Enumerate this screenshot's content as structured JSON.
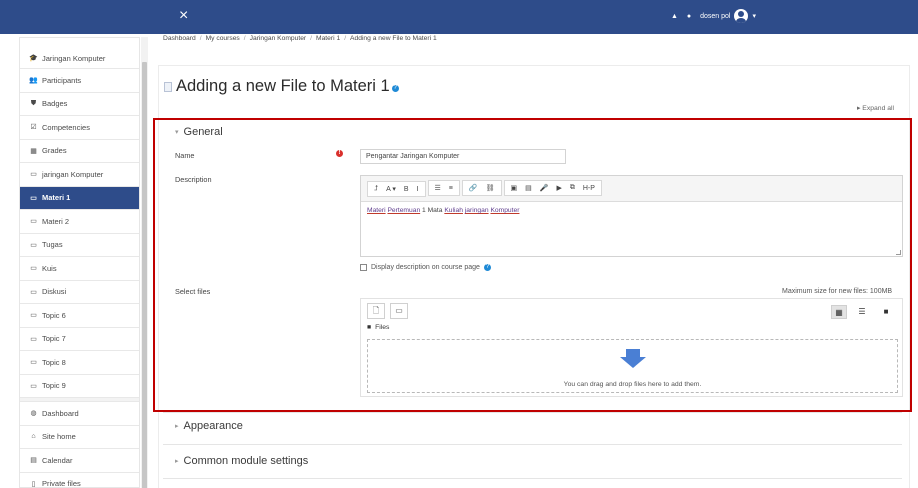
{
  "navbar": {
    "close_icon": "×",
    "username": "dosen pol",
    "caret": "▾",
    "bell_icon": "▲",
    "chat_icon": "●"
  },
  "sidebar": {
    "items": [
      {
        "label": "Jaringan Komputer",
        "icon": "🎓"
      },
      {
        "label": "Participants",
        "icon": "👥"
      },
      {
        "label": "Badges",
        "icon": "⛊"
      },
      {
        "label": "Competencies",
        "icon": "☑"
      },
      {
        "label": "Grades",
        "icon": "▦"
      },
      {
        "label": "jaringan Komputer",
        "icon": "▭"
      },
      {
        "label": "Materi 1",
        "icon": "▭",
        "active": true
      },
      {
        "label": "Materi 2",
        "icon": "▭"
      },
      {
        "label": "Tugas",
        "icon": "▭"
      },
      {
        "label": "Kuis",
        "icon": "▭"
      },
      {
        "label": "Diskusi",
        "icon": "▭"
      },
      {
        "label": "Topic 6",
        "icon": "▭"
      },
      {
        "label": "Topic 7",
        "icon": "▭"
      },
      {
        "label": "Topic 8",
        "icon": "▭"
      },
      {
        "label": "Topic 9",
        "icon": "▭"
      },
      {
        "label": "Dashboard",
        "icon": "◍"
      },
      {
        "label": "Site home",
        "icon": "⌂"
      },
      {
        "label": "Calendar",
        "icon": "▤"
      },
      {
        "label": "Private files",
        "icon": "▯"
      }
    ]
  },
  "breadcrumb": {
    "items": [
      "Dashboard",
      "My courses",
      "Jaringan Komputer",
      "Materi 1",
      "Adding a new File to Materi 1"
    ],
    "separator": "/"
  },
  "page": {
    "title": "Adding a new File to Materi 1",
    "help_icon": "?",
    "expand_all": "▸ Expand all"
  },
  "general": {
    "heading": "General",
    "chevron": "▾",
    "name_label": "Name",
    "required_icon": "!",
    "name_value": "Pengantar Jaringan Komputer",
    "description_label": "Description",
    "toolbar": {
      "g1": [
        "⮥",
        "A ▾",
        "B",
        "I"
      ],
      "g2": [
        "☰",
        "≡"
      ],
      "g3": [
        "🔗",
        "⛓"
      ],
      "g4": [
        "▣",
        "▤",
        "🎤",
        "▶",
        "⧉",
        "H-P"
      ]
    },
    "description_words": [
      {
        "text": "Materi",
        "u": true
      },
      {
        "text": " ",
        "u": false
      },
      {
        "text": "Pertemuan",
        "u": true
      },
      {
        "text": " 1 Mata ",
        "u": false
      },
      {
        "text": "Kuliah",
        "u": true
      },
      {
        "text": " ",
        "u": false
      },
      {
        "text": "jaringan",
        "u": true
      },
      {
        "text": " ",
        "u": false
      },
      {
        "text": "Komputer",
        "u": true
      }
    ],
    "display_desc_label": "Display description on course page",
    "select_files_label": "Select files",
    "max_size": "Maximum size for new files: 100MB",
    "files_path": "Files",
    "drop_text": "You can drag and drop files here to add them."
  },
  "appearance": {
    "heading": "Appearance",
    "chevron": "▸"
  },
  "common": {
    "heading": "Common module settings",
    "chevron": "▸"
  },
  "colors": {
    "navbar": "#2e4c8a",
    "highlight": "#c00000",
    "required": "#d9302c"
  }
}
